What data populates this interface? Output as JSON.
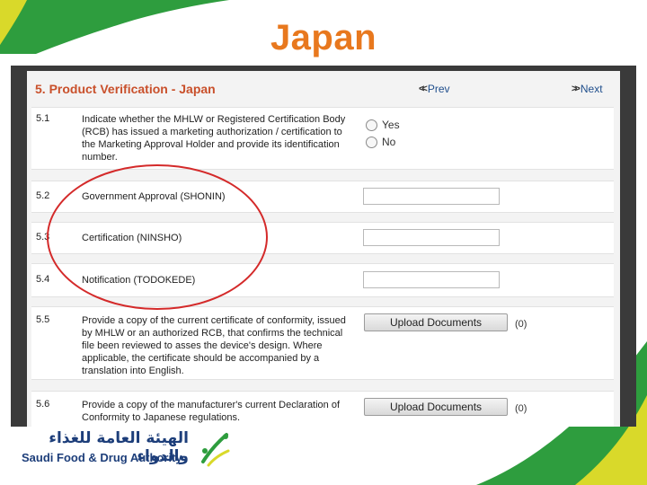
{
  "slide": {
    "title": "Japan"
  },
  "section": {
    "title": "5. Product Verification - Japan",
    "prev_label": "Prev",
    "next_label": "Next"
  },
  "rows": [
    {
      "num": "5.1",
      "question": "Indicate whether the MHLW or Registered Certification Body (RCB) has issued a marketing authorization / certification to the Marketing Approval Holder and provide its identification number.",
      "options": [
        "Yes",
        "No"
      ]
    },
    {
      "num": "5.2",
      "question": "Government Approval (SHONIN)",
      "value": ""
    },
    {
      "num": "5.3",
      "question": "Certification (NINSHO)",
      "value": ""
    },
    {
      "num": "5.4",
      "question": "Notification (TODOKEDE)",
      "value": ""
    },
    {
      "num": "5.5",
      "question": "Provide a copy of the current certificate of conformity, issued by MHLW or an authorized RCB, that confirms the technical file been reviewed to asses the device's design. Where applicable, the certificate should be accompanied by a translation into English.",
      "button_label": "Upload Documents",
      "count": "(0)"
    },
    {
      "num": "5.6",
      "question": "Provide a copy of the manufacturer's current Declaration of Conformity to Japanese regulations.",
      "button_label": "Upload Documents",
      "count": "(0)"
    }
  ],
  "logo": {
    "arabic": "الهيئة العامة للغذاء والدواء",
    "english": "Saudi Food & Drug Authority"
  },
  "colors": {
    "title": "#e8781e",
    "section_title": "#c9502b",
    "annotation_circle": "#d42a2a",
    "green": "#2e9d3e"
  }
}
